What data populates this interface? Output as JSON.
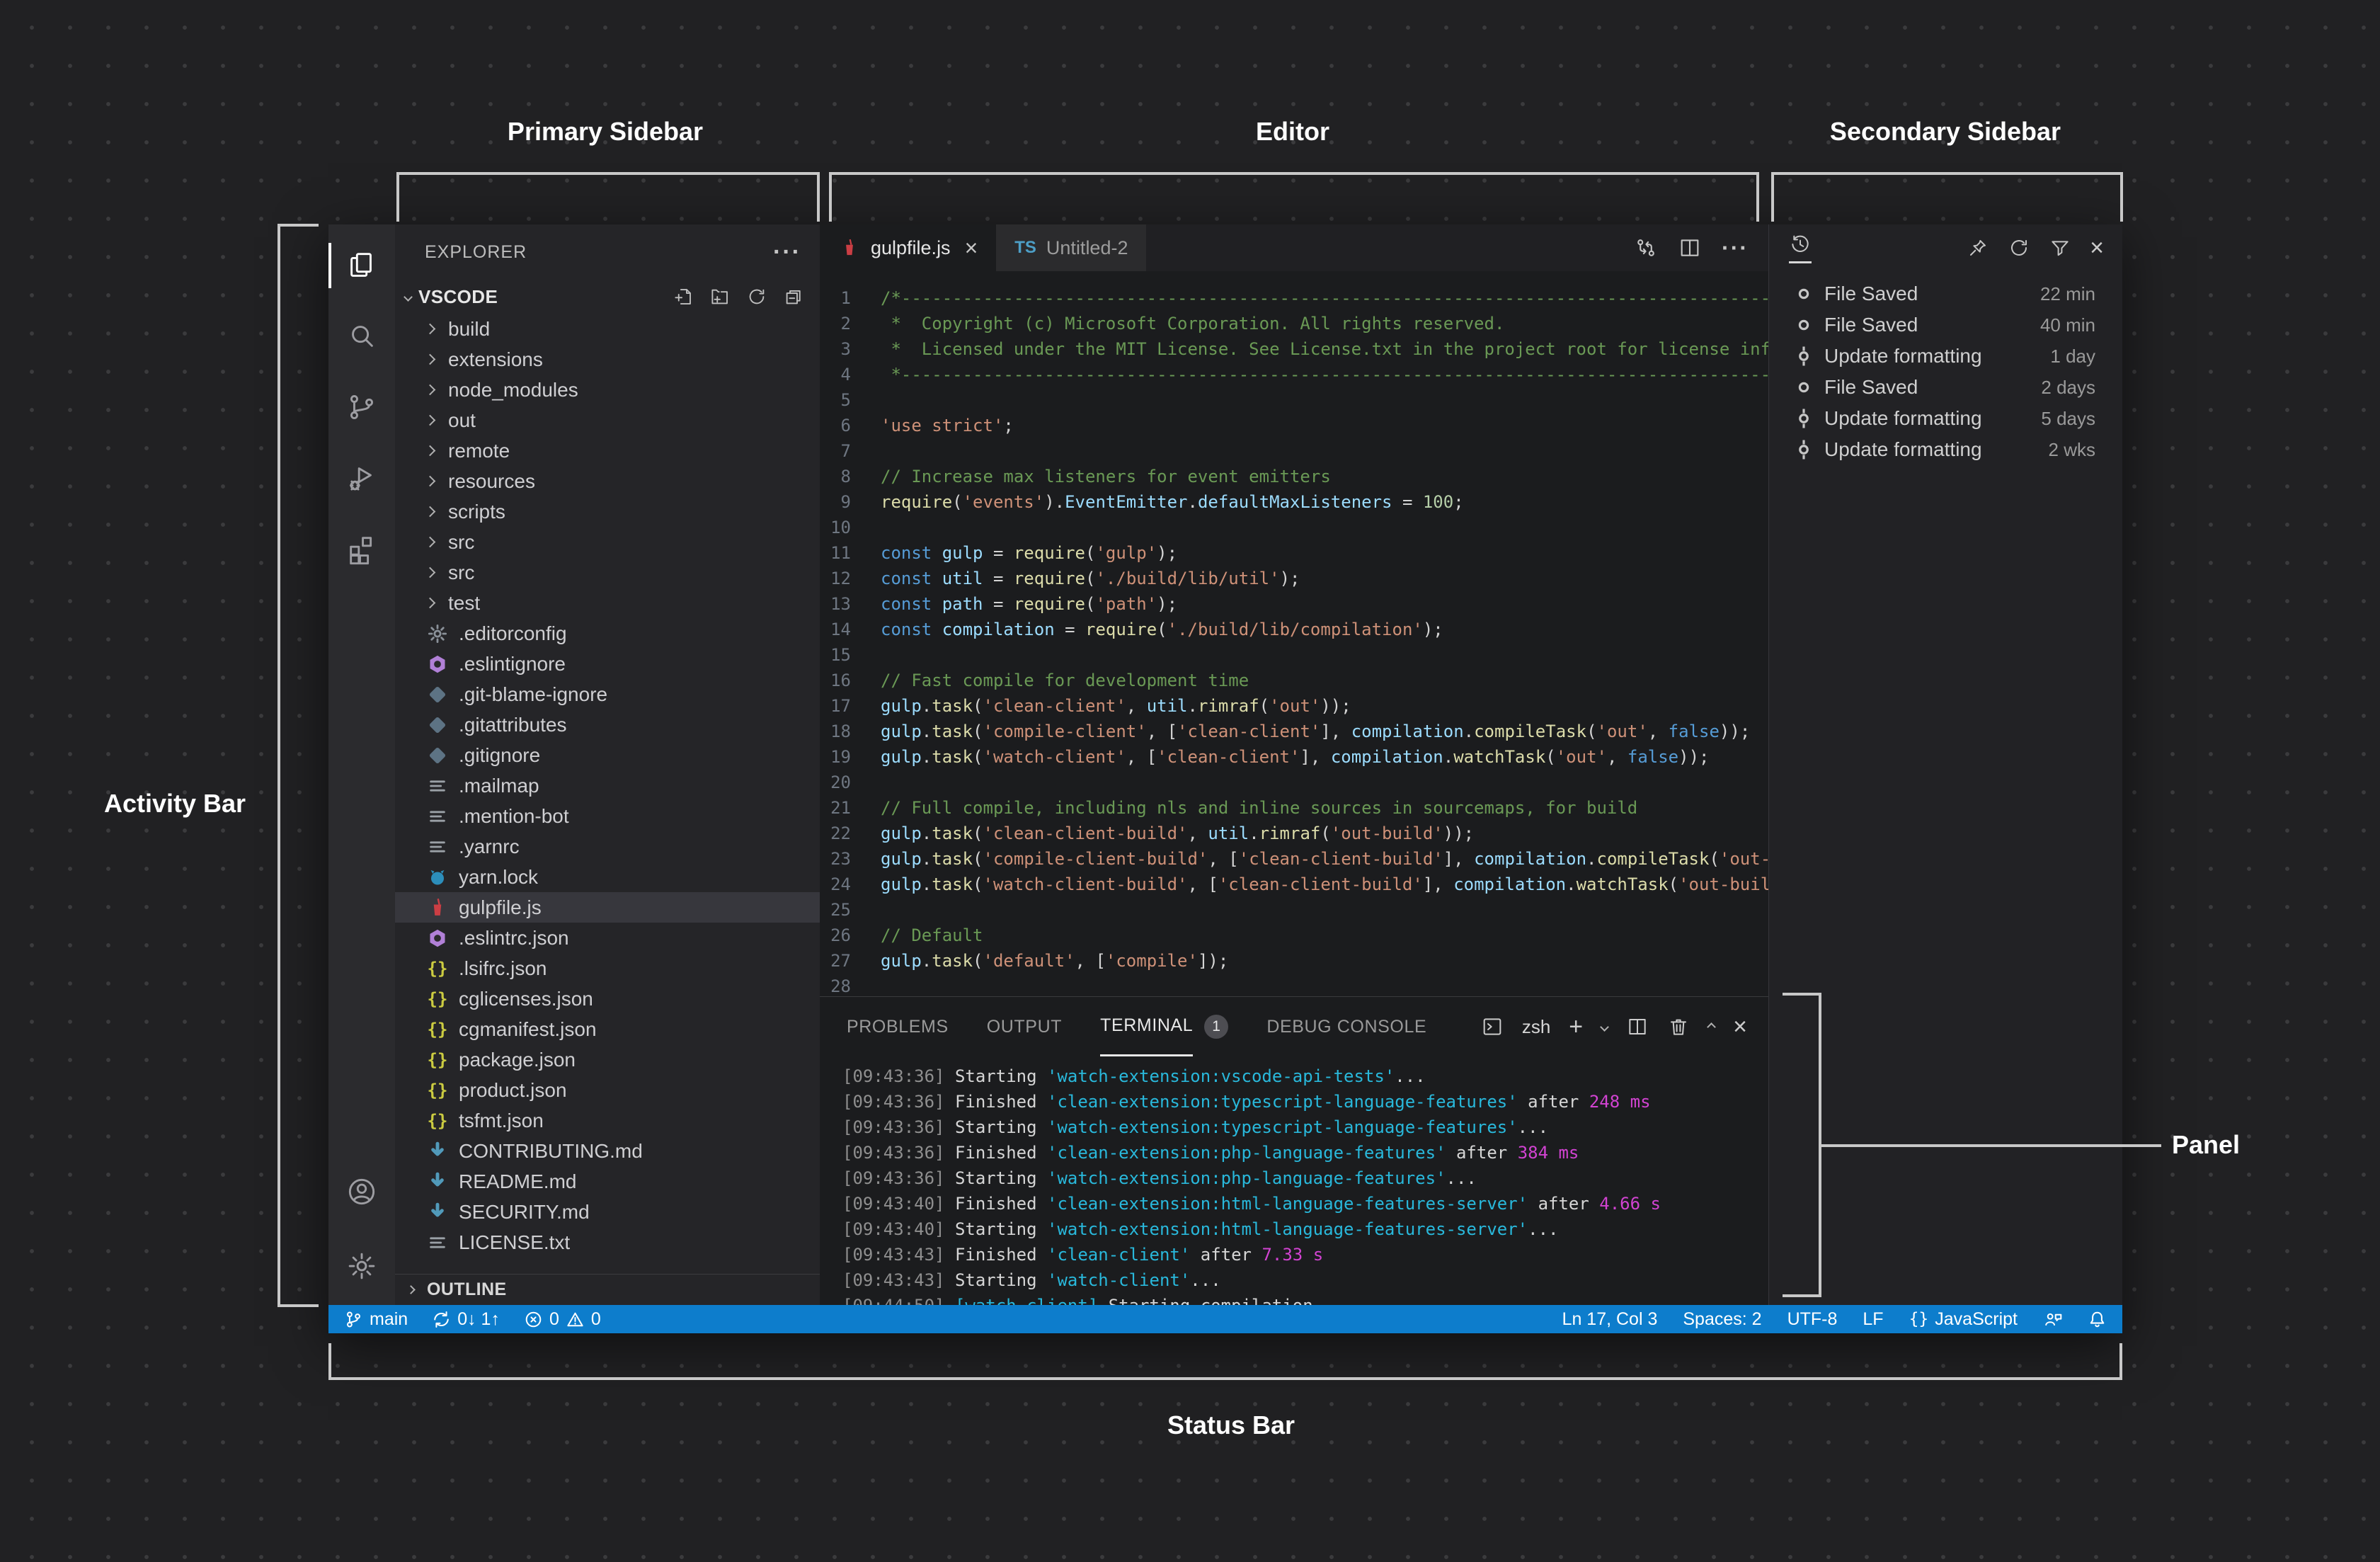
{
  "annotations": {
    "primary_sidebar": "Primary Sidebar",
    "editor": "Editor",
    "secondary_sidebar": "Secondary Sidebar",
    "activity_bar": "Activity Bar",
    "panel": "Panel",
    "status_bar": "Status Bar"
  },
  "explorer": {
    "title": "EXPLORER",
    "section": "VSCODE",
    "outline": "OUTLINE",
    "items": [
      {
        "kind": "folder",
        "name": "build"
      },
      {
        "kind": "folder",
        "name": "extensions"
      },
      {
        "kind": "folder",
        "name": "node_modules"
      },
      {
        "kind": "folder",
        "name": "out"
      },
      {
        "kind": "folder",
        "name": "remote"
      },
      {
        "kind": "folder",
        "name": "resources"
      },
      {
        "kind": "folder",
        "name": "scripts"
      },
      {
        "kind": "folder",
        "name": "src"
      },
      {
        "kind": "folder",
        "name": "src"
      },
      {
        "kind": "folder",
        "name": "test"
      },
      {
        "kind": "file",
        "icon": "gear-file",
        "name": ".editorconfig"
      },
      {
        "kind": "file",
        "icon": "eslint",
        "name": ".eslintignore"
      },
      {
        "kind": "file",
        "icon": "git",
        "name": ".git-blame-ignore"
      },
      {
        "kind": "file",
        "icon": "git",
        "name": ".gitattributes"
      },
      {
        "kind": "file",
        "icon": "git",
        "name": ".gitignore"
      },
      {
        "kind": "file",
        "icon": "lines",
        "name": ".mailmap"
      },
      {
        "kind": "file",
        "icon": "lines",
        "name": ".mention-bot"
      },
      {
        "kind": "file",
        "icon": "lines",
        "name": ".yarnrc"
      },
      {
        "kind": "file",
        "icon": "yarn",
        "name": "yarn.lock"
      },
      {
        "kind": "file",
        "icon": "gulp",
        "name": "gulpfile.js",
        "selected": true
      },
      {
        "kind": "file",
        "icon": "eslint",
        "name": ".eslintrc.json"
      },
      {
        "kind": "file",
        "icon": "json",
        "name": ".lsifrc.json"
      },
      {
        "kind": "file",
        "icon": "json",
        "name": "cglicenses.json"
      },
      {
        "kind": "file",
        "icon": "json",
        "name": "cgmanifest.json"
      },
      {
        "kind": "file",
        "icon": "json",
        "name": "package.json"
      },
      {
        "kind": "file",
        "icon": "json",
        "name": "product.json"
      },
      {
        "kind": "file",
        "icon": "json",
        "name": "tsfmt.json"
      },
      {
        "kind": "file",
        "icon": "md",
        "name": "CONTRIBUTING.md"
      },
      {
        "kind": "file",
        "icon": "md",
        "name": "README.md"
      },
      {
        "kind": "file",
        "icon": "md",
        "name": "SECURITY.md"
      },
      {
        "kind": "file",
        "icon": "lines",
        "name": "LICENSE.txt"
      }
    ]
  },
  "tabs": {
    "active": {
      "label": "gulpfile.js"
    },
    "inactive": {
      "label": "Untitled-2",
      "badge": "TS"
    }
  },
  "code": {
    "lines": [
      {
        "n": 1,
        "t": [
          [
            "c",
            "/*---------------------------------------------------------------------------------------------------"
          ]
        ]
      },
      {
        "n": 2,
        "t": [
          [
            "c",
            " *  Copyright (c) Microsoft Corporation. All rights reserved."
          ]
        ]
      },
      {
        "n": 3,
        "t": [
          [
            "c",
            " *  Licensed under the MIT License. See License.txt in the project root for license information."
          ]
        ]
      },
      {
        "n": 4,
        "t": [
          [
            "c",
            " *--------------------------------------------------------------------------------------------------*/"
          ]
        ]
      },
      {
        "n": 5,
        "t": []
      },
      {
        "n": 6,
        "t": [
          [
            "s",
            "'use strict'"
          ],
          [
            "p",
            ";"
          ]
        ]
      },
      {
        "n": 7,
        "t": []
      },
      {
        "n": 8,
        "t": [
          [
            "c",
            "// Increase max listeners for event emitters"
          ]
        ]
      },
      {
        "n": 9,
        "t": [
          [
            "f",
            "require"
          ],
          [
            "p",
            "("
          ],
          [
            "s",
            "'events'"
          ],
          [
            "p",
            ")."
          ],
          [
            "v",
            "EventEmitter"
          ],
          [
            "p",
            "."
          ],
          [
            "v",
            "defaultMaxListeners"
          ],
          [
            "p",
            " = "
          ],
          [
            "n2",
            "100"
          ],
          [
            "p",
            ";"
          ]
        ]
      },
      {
        "n": 10,
        "t": []
      },
      {
        "n": 11,
        "t": [
          [
            "k",
            "const"
          ],
          [
            "p",
            " "
          ],
          [
            "v",
            "gulp"
          ],
          [
            "p",
            " = "
          ],
          [
            "f",
            "require"
          ],
          [
            "p",
            "("
          ],
          [
            "s",
            "'gulp'"
          ],
          [
            "p",
            ");"
          ]
        ]
      },
      {
        "n": 12,
        "t": [
          [
            "k",
            "const"
          ],
          [
            "p",
            " "
          ],
          [
            "v",
            "util"
          ],
          [
            "p",
            " = "
          ],
          [
            "f",
            "require"
          ],
          [
            "p",
            "("
          ],
          [
            "s",
            "'./build/lib/util'"
          ],
          [
            "p",
            ");"
          ]
        ]
      },
      {
        "n": 13,
        "t": [
          [
            "k",
            "const"
          ],
          [
            "p",
            " "
          ],
          [
            "v",
            "path"
          ],
          [
            "p",
            " = "
          ],
          [
            "f",
            "require"
          ],
          [
            "p",
            "("
          ],
          [
            "s",
            "'path'"
          ],
          [
            "p",
            ");"
          ]
        ]
      },
      {
        "n": 14,
        "t": [
          [
            "k",
            "const"
          ],
          [
            "p",
            " "
          ],
          [
            "v",
            "compilation"
          ],
          [
            "p",
            " = "
          ],
          [
            "f",
            "require"
          ],
          [
            "p",
            "("
          ],
          [
            "s",
            "'./build/lib/compilation'"
          ],
          [
            "p",
            ");"
          ]
        ]
      },
      {
        "n": 15,
        "t": []
      },
      {
        "n": 16,
        "t": [
          [
            "c",
            "// Fast compile for development time"
          ]
        ]
      },
      {
        "n": 17,
        "t": [
          [
            "v",
            "gulp"
          ],
          [
            "p",
            "."
          ],
          [
            "f",
            "task"
          ],
          [
            "p",
            "("
          ],
          [
            "s",
            "'clean-client'"
          ],
          [
            "p",
            ", "
          ],
          [
            "v",
            "util"
          ],
          [
            "p",
            "."
          ],
          [
            "f",
            "rimraf"
          ],
          [
            "p",
            "("
          ],
          [
            "s",
            "'out'"
          ],
          [
            "p",
            "));"
          ]
        ]
      },
      {
        "n": 18,
        "t": [
          [
            "v",
            "gulp"
          ],
          [
            "p",
            "."
          ],
          [
            "f",
            "task"
          ],
          [
            "p",
            "("
          ],
          [
            "s",
            "'compile-client'"
          ],
          [
            "p",
            ", ["
          ],
          [
            "s",
            "'clean-client'"
          ],
          [
            "p",
            "], "
          ],
          [
            "v",
            "compilation"
          ],
          [
            "p",
            "."
          ],
          [
            "f",
            "compileTask"
          ],
          [
            "p",
            "("
          ],
          [
            "s",
            "'out'"
          ],
          [
            "p",
            ", "
          ],
          [
            "k",
            "false"
          ],
          [
            "p",
            "));"
          ]
        ]
      },
      {
        "n": 19,
        "t": [
          [
            "v",
            "gulp"
          ],
          [
            "p",
            "."
          ],
          [
            "f",
            "task"
          ],
          [
            "p",
            "("
          ],
          [
            "s",
            "'watch-client'"
          ],
          [
            "p",
            ", ["
          ],
          [
            "s",
            "'clean-client'"
          ],
          [
            "p",
            "], "
          ],
          [
            "v",
            "compilation"
          ],
          [
            "p",
            "."
          ],
          [
            "f",
            "watchTask"
          ],
          [
            "p",
            "("
          ],
          [
            "s",
            "'out'"
          ],
          [
            "p",
            ", "
          ],
          [
            "k",
            "false"
          ],
          [
            "p",
            "));"
          ]
        ]
      },
      {
        "n": 20,
        "t": []
      },
      {
        "n": 21,
        "t": [
          [
            "c",
            "// Full compile, including nls and inline sources in sourcemaps, for build"
          ]
        ]
      },
      {
        "n": 22,
        "t": [
          [
            "v",
            "gulp"
          ],
          [
            "p",
            "."
          ],
          [
            "f",
            "task"
          ],
          [
            "p",
            "("
          ],
          [
            "s",
            "'clean-client-build'"
          ],
          [
            "p",
            ", "
          ],
          [
            "v",
            "util"
          ],
          [
            "p",
            "."
          ],
          [
            "f",
            "rimraf"
          ],
          [
            "p",
            "("
          ],
          [
            "s",
            "'out-build'"
          ],
          [
            "p",
            "));"
          ]
        ]
      },
      {
        "n": 23,
        "t": [
          [
            "v",
            "gulp"
          ],
          [
            "p",
            "."
          ],
          [
            "f",
            "task"
          ],
          [
            "p",
            "("
          ],
          [
            "s",
            "'compile-client-build'"
          ],
          [
            "p",
            ", ["
          ],
          [
            "s",
            "'clean-client-build'"
          ],
          [
            "p",
            "], "
          ],
          [
            "v",
            "compilation"
          ],
          [
            "p",
            "."
          ],
          [
            "f",
            "compileTask"
          ],
          [
            "p",
            "("
          ],
          [
            "s",
            "'out-build'"
          ],
          [
            "p",
            ", "
          ],
          [
            "k",
            "false"
          ],
          [
            "p",
            "));"
          ]
        ]
      },
      {
        "n": 24,
        "t": [
          [
            "v",
            "gulp"
          ],
          [
            "p",
            "."
          ],
          [
            "f",
            "task"
          ],
          [
            "p",
            "("
          ],
          [
            "s",
            "'watch-client-build'"
          ],
          [
            "p",
            ", ["
          ],
          [
            "s",
            "'clean-client-build'"
          ],
          [
            "p",
            "], "
          ],
          [
            "v",
            "compilation"
          ],
          [
            "p",
            "."
          ],
          [
            "f",
            "watchTask"
          ],
          [
            "p",
            "("
          ],
          [
            "s",
            "'out-build'"
          ],
          [
            "p",
            ", "
          ],
          [
            "k",
            "false"
          ],
          [
            "p",
            "));"
          ]
        ]
      },
      {
        "n": 25,
        "t": []
      },
      {
        "n": 26,
        "t": [
          [
            "c",
            "// Default"
          ]
        ]
      },
      {
        "n": 27,
        "t": [
          [
            "v",
            "gulp"
          ],
          [
            "p",
            "."
          ],
          [
            "f",
            "task"
          ],
          [
            "p",
            "("
          ],
          [
            "s",
            "'default'"
          ],
          [
            "p",
            ", ["
          ],
          [
            "s",
            "'compile'"
          ],
          [
            "p",
            "]);"
          ]
        ]
      },
      {
        "n": 28,
        "t": []
      }
    ]
  },
  "panel": {
    "tabs": [
      "PROBLEMS",
      "OUTPUT",
      "TERMINAL",
      "DEBUG CONSOLE"
    ],
    "active_tab": "TERMINAL",
    "badge": "1",
    "shell": "zsh",
    "lines": [
      [
        [
          "d",
          "[09:43:36] "
        ],
        [
          "p",
          "Starting "
        ],
        [
          "t",
          "'watch-extension:vscode-api-tests'"
        ],
        [
          "p",
          "..."
        ]
      ],
      [
        [
          "d",
          "[09:43:36] "
        ],
        [
          "p",
          "Finished "
        ],
        [
          "t",
          "'clean-extension:typescript-language-features'"
        ],
        [
          "p",
          " after "
        ],
        [
          "m",
          "248 ms"
        ]
      ],
      [
        [
          "d",
          "[09:43:36] "
        ],
        [
          "p",
          "Starting "
        ],
        [
          "t",
          "'watch-extension:typescript-language-features'"
        ],
        [
          "p",
          "..."
        ]
      ],
      [
        [
          "d",
          "[09:43:36] "
        ],
        [
          "p",
          "Finished "
        ],
        [
          "t",
          "'clean-extension:php-language-features'"
        ],
        [
          "p",
          " after "
        ],
        [
          "m",
          "384 ms"
        ]
      ],
      [
        [
          "d",
          "[09:43:36] "
        ],
        [
          "p",
          "Starting "
        ],
        [
          "t",
          "'watch-extension:php-language-features'"
        ],
        [
          "p",
          "..."
        ]
      ],
      [
        [
          "d",
          "[09:43:40] "
        ],
        [
          "p",
          "Finished "
        ],
        [
          "t",
          "'clean-extension:html-language-features-server'"
        ],
        [
          "p",
          " after "
        ],
        [
          "m",
          "4.66 s"
        ]
      ],
      [
        [
          "d",
          "[09:43:40] "
        ],
        [
          "p",
          "Starting "
        ],
        [
          "t",
          "'watch-extension:html-language-features-server'"
        ],
        [
          "p",
          "..."
        ]
      ],
      [
        [
          "d",
          "[09:43:43] "
        ],
        [
          "p",
          "Finished "
        ],
        [
          "t",
          "'clean-client'"
        ],
        [
          "p",
          " after "
        ],
        [
          "m",
          "7.33 s"
        ]
      ],
      [
        [
          "d",
          "[09:43:43] "
        ],
        [
          "p",
          "Starting "
        ],
        [
          "t",
          "'watch-client'"
        ],
        [
          "p",
          "..."
        ]
      ],
      [
        [
          "d",
          "[09:44:50] "
        ],
        [
          "t",
          "[watch-client]"
        ],
        [
          "p",
          " Starting compilation..."
        ]
      ]
    ]
  },
  "timeline": {
    "items": [
      {
        "icon": "circle",
        "label": "File Saved",
        "time": "22 min"
      },
      {
        "icon": "circle",
        "label": "File Saved",
        "time": "40 min"
      },
      {
        "icon": "commit",
        "label": "Update formatting",
        "time": "1 day"
      },
      {
        "icon": "circle",
        "label": "File Saved",
        "time": "2 days"
      },
      {
        "icon": "commit",
        "label": "Update formatting",
        "time": "5 days"
      },
      {
        "icon": "commit",
        "label": "Update formatting",
        "time": "2 wks"
      }
    ]
  },
  "status_bar": {
    "branch": "main",
    "sync": "0↓ 1↑",
    "errors": "0",
    "warnings": "0",
    "line_col": "Ln 17, Col 3",
    "spaces": "Spaces: 2",
    "encoding": "UTF-8",
    "eol": "LF",
    "language_prefix": "{}",
    "language": "JavaScript"
  },
  "icons": [
    "files-icon",
    "search-icon",
    "source-control-icon",
    "run-debug-icon",
    "extensions-icon",
    "account-icon",
    "settings-gear-icon",
    "ellipsis-icon",
    "new-file-icon",
    "new-folder-icon",
    "refresh-icon",
    "collapse-all-icon",
    "chevron-down-icon",
    "chevron-right-icon",
    "gulp-icon",
    "close-icon",
    "open-changes-icon",
    "split-editor-icon",
    "terminal-icon",
    "add-icon",
    "trash-icon",
    "chevron-up-icon",
    "history-icon",
    "pin-icon",
    "filter-icon",
    "git-branch-icon",
    "sync-icon",
    "error-icon",
    "warning-icon",
    "feedback-icon",
    "bell-icon"
  ],
  "colors": {
    "status_bar_bg": "#0d7dcc",
    "selection_row": "#37373d",
    "comment": "#6a9955",
    "string": "#ce9178",
    "keyword": "#569cd6",
    "variable": "#9cdcfe",
    "function": "#dcdcaa",
    "number": "#b5cea8",
    "terminal_task": "#29b8db",
    "terminal_duration": "#d243d2",
    "annotation": "#c8c8c8"
  }
}
